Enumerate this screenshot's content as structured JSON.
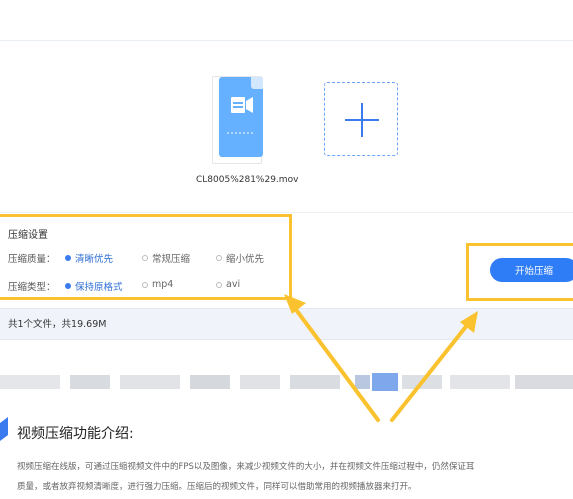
{
  "file": {
    "name": "CL8005%281%29.mov",
    "icon": "video-file-icon"
  },
  "add_button": {
    "icon": "plus-icon"
  },
  "settings": {
    "title": "压缩设置",
    "quality_label": "压缩质量：",
    "quality_options": [
      "清晰优先",
      "常规压缩",
      "缩小优先"
    ],
    "quality_selected": "清晰优先",
    "type_label": "压缩类型：",
    "type_options": [
      "保持原格式",
      "mp4",
      "avi"
    ],
    "type_selected": "保持原格式"
  },
  "start_button": {
    "label": "开始压缩"
  },
  "summary": {
    "text": "共1个文件，共19.69M"
  },
  "intro": {
    "title": "视频压缩功能介绍:",
    "line1": "视频压缩在线版，可通过压缩视频文件中的FPS以及图像，来减少视频文件的大小，并在视频文件压缩过程中，仍然保证耳",
    "line2": "质量，或者放弃视频清晰度，进行强力压缩。压缩后的视频文件，同样可以借助常用的视频播放器来打开。"
  },
  "colors": {
    "accent": "#2e7cf6",
    "highlight": "#f9c22e",
    "file_blue": "#66b1ff"
  }
}
